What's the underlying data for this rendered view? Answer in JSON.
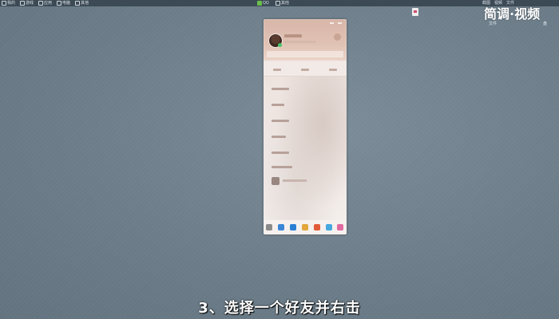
{
  "taskbar": {
    "left_items": [
      {
        "icon": "document-icon",
        "label": "我的"
      },
      {
        "icon": "folder-icon",
        "label": "游戏"
      },
      {
        "icon": "app-icon",
        "label": "应用"
      },
      {
        "icon": "download-icon",
        "label": "电脑"
      },
      {
        "icon": "gear-icon",
        "label": "其他"
      }
    ],
    "mid_items": [
      {
        "icon": "qq-icon",
        "label": "QQ"
      },
      {
        "icon": "penguin-icon",
        "label": "其他"
      }
    ],
    "right_items": [
      "截图",
      "视频",
      "文件"
    ]
  },
  "watermark": {
    "text": "简调·视频",
    "sub_left": "文件",
    "sub_right": "盘"
  },
  "qq_panel": {
    "accent_green": "#49c26b",
    "bottom_icons": [
      "menu-icon",
      "contacts-icon",
      "file-icon",
      "mail-icon",
      "game-icon",
      "weather-icon",
      "app-manager-icon"
    ],
    "bottom_colors": [
      "#8a8a8a",
      "#3a86d6",
      "#2a7fd4",
      "#e2a63b",
      "#e35c3a",
      "#47a8e0",
      "#e06aa0"
    ]
  },
  "subtitle": "3、选择一个好友并右击"
}
